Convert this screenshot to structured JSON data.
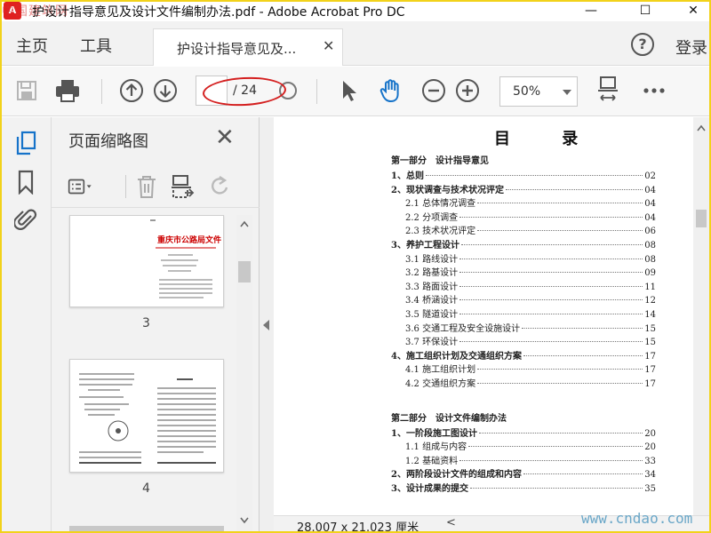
{
  "window": {
    "watermark": "中国建筑网",
    "title": "护设计指导意见及设计文件编制办法.pdf - Adobe Acrobat Pro DC",
    "minimize": "—",
    "maximize": "☐",
    "close": "✕"
  },
  "menu": {
    "home": "主页",
    "tools": "工具",
    "tab_label": "护设计指导意见及...",
    "tab_close": "✕",
    "help": "?",
    "signin": "登录"
  },
  "toolbar": {
    "current_page": "",
    "page_total": "/ 24",
    "zoom": "50%"
  },
  "panel": {
    "title": "页面缩略图",
    "close": "✕",
    "thumbnails": [
      {
        "page": "3",
        "heading": "重庆市公路局文件"
      },
      {
        "page": "4",
        "heading": ""
      }
    ]
  },
  "document": {
    "title": "目 录",
    "toc": [
      {
        "kind": "part",
        "label": "第一部分　设计指导意见"
      },
      {
        "kind": "main",
        "label": "1、总则",
        "page": "02"
      },
      {
        "kind": "main",
        "label": "2、现状调查与技术状况评定",
        "page": "04"
      },
      {
        "kind": "sub",
        "label": "2.1 总体情况调查",
        "page": "04"
      },
      {
        "kind": "sub",
        "label": "2.2 分项调查",
        "page": "04"
      },
      {
        "kind": "sub",
        "label": "2.3 技术状况评定",
        "page": "06"
      },
      {
        "kind": "main",
        "label": "3、养护工程设计",
        "page": "08"
      },
      {
        "kind": "sub",
        "label": "3.1 路线设计",
        "page": "08"
      },
      {
        "kind": "sub",
        "label": "3.2 路基设计",
        "page": "09"
      },
      {
        "kind": "sub",
        "label": "3.3 路面设计",
        "page": "11"
      },
      {
        "kind": "sub",
        "label": "3.4 桥涵设计",
        "page": "12"
      },
      {
        "kind": "sub",
        "label": "3.5 隧道设计",
        "page": "14"
      },
      {
        "kind": "sub",
        "label": "3.6 交通工程及安全设施设计",
        "page": "15"
      },
      {
        "kind": "sub",
        "label": "3.7 环保设计",
        "page": "15"
      },
      {
        "kind": "main",
        "label": "4、施工组织计划及交通组织方案",
        "page": "17"
      },
      {
        "kind": "sub",
        "label": "4.1 施工组织计划",
        "page": "17"
      },
      {
        "kind": "sub",
        "label": "4.2 交通组织方案",
        "page": "17"
      },
      {
        "kind": "gap"
      },
      {
        "kind": "part",
        "label": "第二部分　设计文件编制办法"
      },
      {
        "kind": "main",
        "label": "1、一阶段施工图设计",
        "page": "20"
      },
      {
        "kind": "sub",
        "label": "1.1 组成与内容",
        "page": "20"
      },
      {
        "kind": "sub",
        "label": "1.2 基础资料",
        "page": "33"
      },
      {
        "kind": "main",
        "label": "2、两阶段设计文件的组成和内容",
        "page": "34"
      },
      {
        "kind": "main",
        "label": "3、设计成果的提交",
        "page": "35"
      }
    ]
  },
  "status": {
    "dimensions": "28.007 x 21.023 厘米",
    "scroll_left": "<"
  },
  "watermark_br": "www.cndao.com"
}
